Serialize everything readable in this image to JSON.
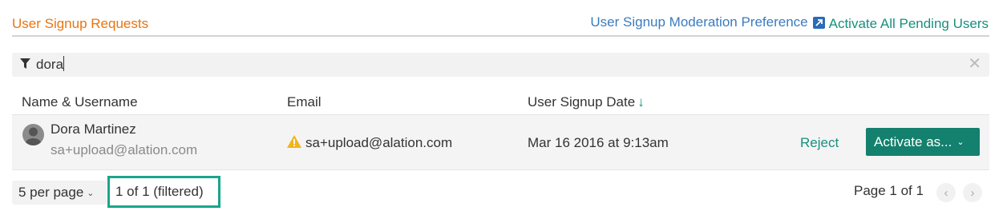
{
  "header": {
    "title": "User Signup Requests",
    "moderation_link": "User Signup Moderation Preference",
    "activate_all_link": "Activate All Pending Users"
  },
  "filter": {
    "value": "dora",
    "icon": "filter-icon",
    "clear_icon": "close-icon"
  },
  "table": {
    "columns": [
      "Name & Username",
      "Email",
      "User Signup Date"
    ],
    "sort_indicator": "↓",
    "rows": [
      {
        "name": "Dora Martinez",
        "username": "sa+upload@alation.com",
        "email": "sa+upload@alation.com",
        "email_warning_icon": "warning-icon",
        "signup_date": "Mar 16 2016 at 9:13am",
        "reject_label": "Reject",
        "activate_label": "Activate as..."
      }
    ]
  },
  "footer": {
    "per_page_label": "5 per page",
    "count_label": "1 of 1 (filtered)",
    "page_label": "Page 1 of 1",
    "prev_icon": "chevron-left-icon",
    "next_icon": "chevron-right-icon"
  },
  "colors": {
    "title": "#e87511",
    "link_blue": "#3a7bbf",
    "teal": "#17907d",
    "button_bg": "#14806e",
    "highlight_border": "#1aa58b"
  }
}
